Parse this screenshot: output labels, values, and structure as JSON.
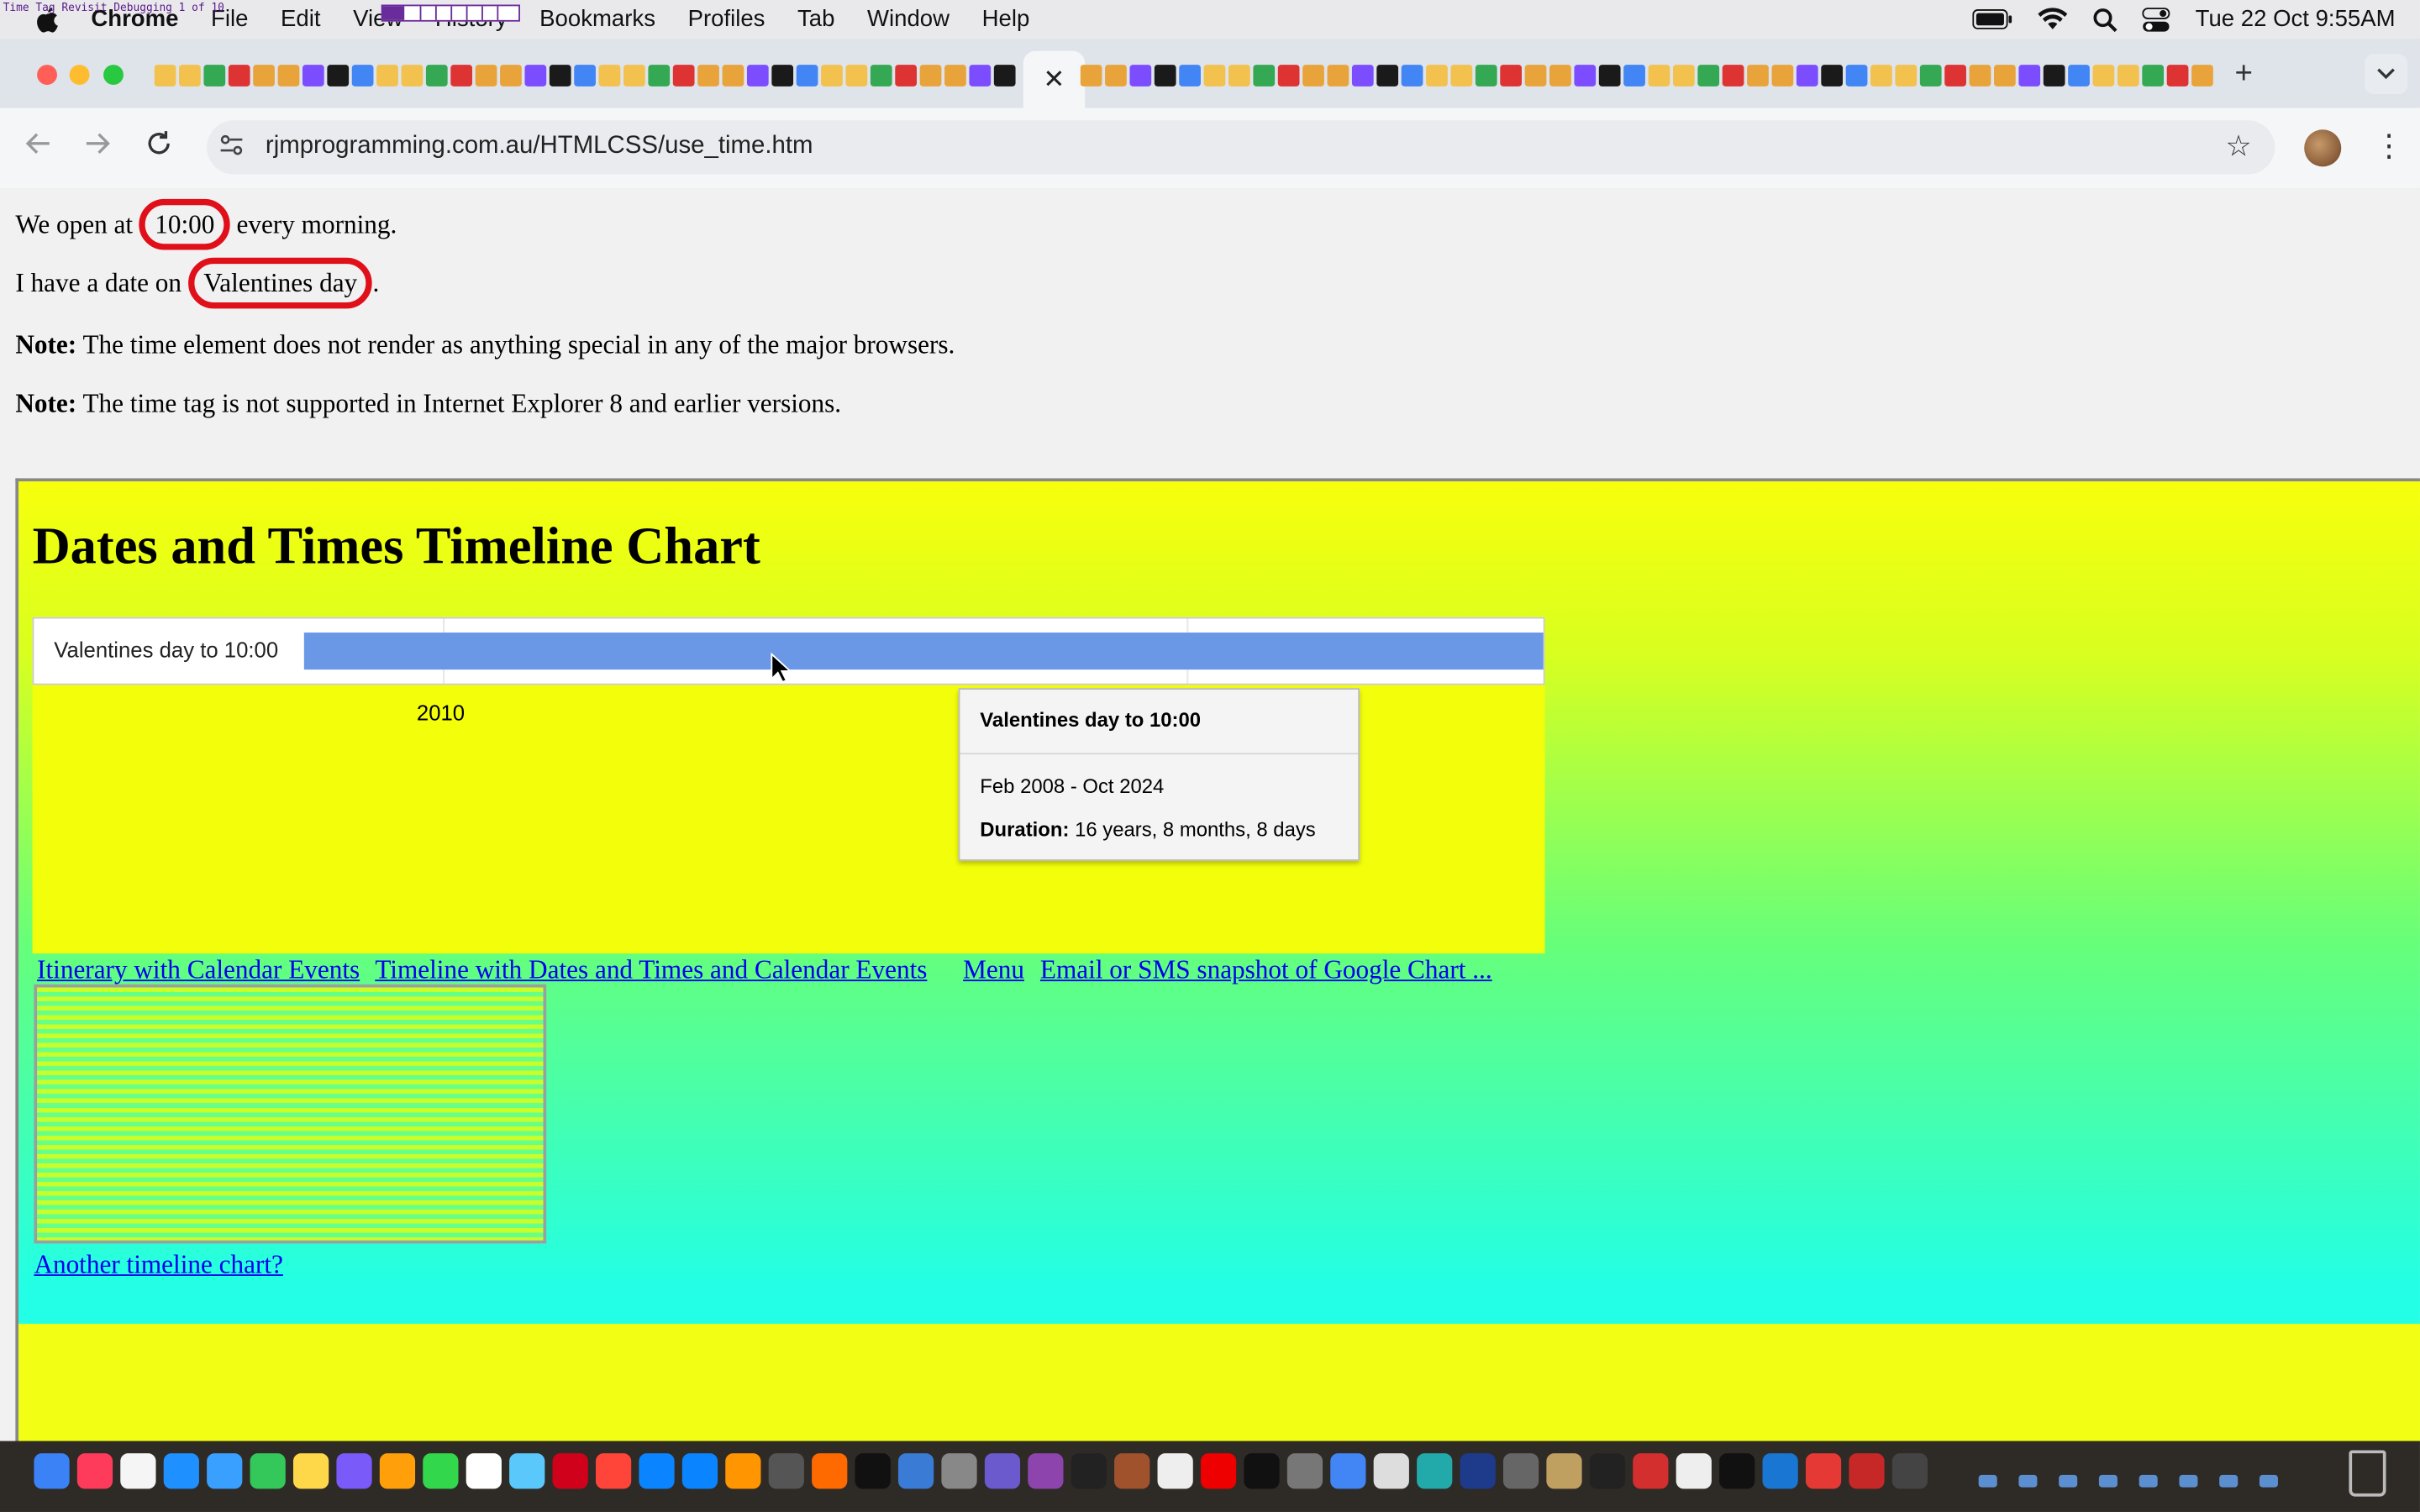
{
  "menubar": {
    "app_name": "Chrome",
    "items": [
      "File",
      "Edit",
      "View",
      "History",
      "Bookmarks",
      "Profiles",
      "Tab",
      "Window",
      "Help"
    ],
    "clock": "Tue 22 Oct  9:55AM",
    "debug_title": "Time Tag Revisit Debugging    1 of 10"
  },
  "browser": {
    "active_tab_close": "✕",
    "new_tab": "+",
    "url": "rjmprogramming.com.au/HTMLCSS/use_time.htm"
  },
  "page": {
    "line1": {
      "before": "We open at ",
      "time": "10:00",
      "after": " every morning."
    },
    "line2": {
      "before": "I have a date on ",
      "date": "Valentines day",
      "after": "."
    },
    "note1": {
      "label": "Note:",
      "text": " The time element does not render as anything special in any of the major browsers."
    },
    "note2": {
      "label": "Note:",
      "text": " The time tag is not supported in Internet Explorer 8 and earlier versions."
    }
  },
  "chart_data": {
    "type": "timeline",
    "title": "Dates and Times Timeline Chart",
    "rows": [
      {
        "label": "Valentines day to 10:00",
        "start": "2008-02-14",
        "end": "2024-10-22",
        "color": "#6a98e6"
      }
    ],
    "x_tick_labels": [
      "2010"
    ],
    "tooltip": {
      "title": "Valentines day to 10:00",
      "range": "Feb 2008 - Oct 2024",
      "duration_label": "Duration:",
      "duration_value": " 16 years, 8 months, 8 days"
    }
  },
  "links": {
    "itinerary": "Itinerary with Calendar Events",
    "timeline": "Timeline with Dates and Times and Calendar Events",
    "menu": "Menu",
    "email": "Email or SMS snapshot of Google Chart ...",
    "another": "Another timeline chart?"
  },
  "colors": {
    "accent_circle": "#e0101a",
    "bar": "#6a98e6",
    "link": "#0000ee"
  }
}
